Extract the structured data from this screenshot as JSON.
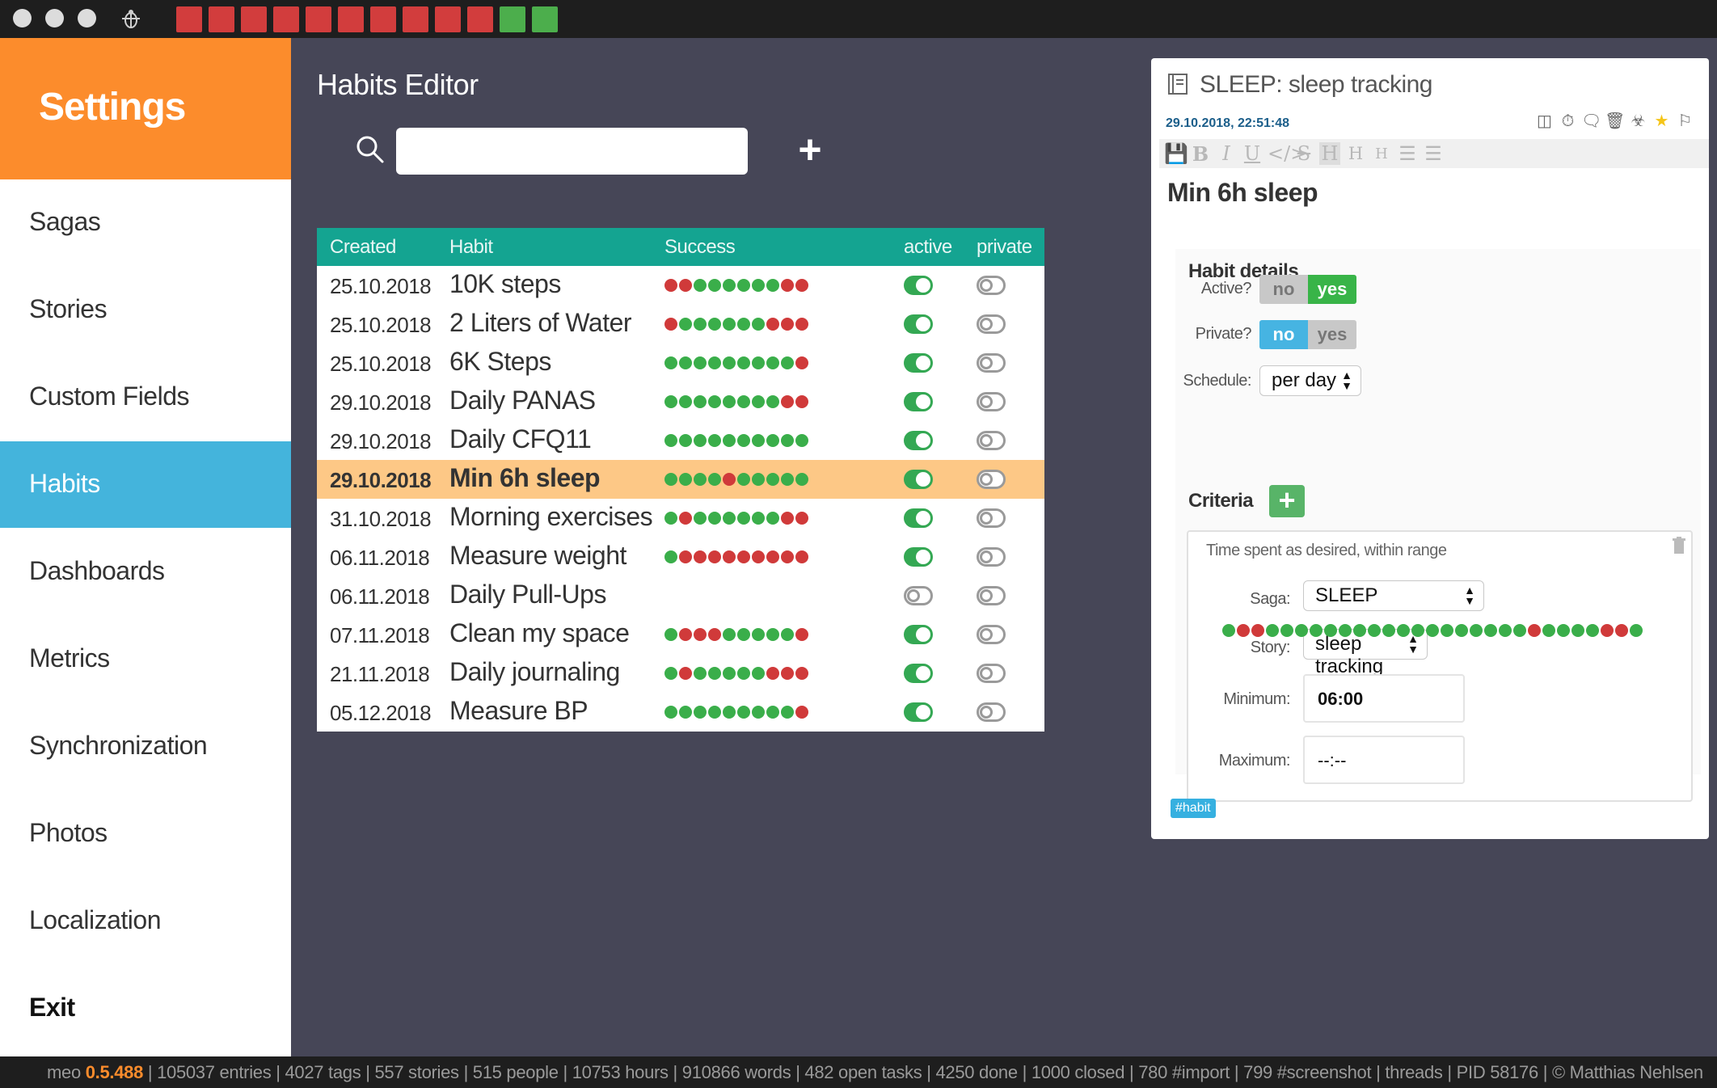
{
  "titlebar": {
    "blocks": [
      "#d23d3d",
      "#d23d3d",
      "#d23d3d",
      "#d23d3d",
      "#d23d3d",
      "#d23d3d",
      "#d23d3d",
      "#d23d3d",
      "#d23d3d",
      "#d23d3d",
      "#4cae4c",
      "#4cae4c"
    ]
  },
  "sidebar": {
    "title": "Settings",
    "items": [
      {
        "label": "Sagas"
      },
      {
        "label": "Stories"
      },
      {
        "label": "Custom Fields"
      },
      {
        "label": "Habits",
        "active": true
      },
      {
        "label": "Dashboards"
      },
      {
        "label": "Metrics"
      },
      {
        "label": "Synchronization"
      },
      {
        "label": "Photos"
      },
      {
        "label": "Localization"
      },
      {
        "label": "Exit"
      }
    ]
  },
  "editor": {
    "title": "Habits Editor",
    "search_value": "",
    "add_label": "+"
  },
  "table": {
    "headers": {
      "created": "Created",
      "habit": "Habit",
      "success": "Success",
      "active": "active",
      "private": "private"
    },
    "rows": [
      {
        "created": "25.10.2018",
        "habit": "10K steps",
        "dots": "rrggggggrr",
        "active": true,
        "private": false
      },
      {
        "created": "25.10.2018",
        "habit": "2 Liters of Water",
        "dots": "rggggggrrr",
        "active": true,
        "private": false
      },
      {
        "created": "25.10.2018",
        "habit": "6K Steps",
        "dots": "gggggggggr",
        "active": true,
        "private": false
      },
      {
        "created": "29.10.2018",
        "habit": "Daily PANAS",
        "dots": "ggggggggrr",
        "active": true,
        "private": false
      },
      {
        "created": "29.10.2018",
        "habit": "Daily CFQ11",
        "dots": "gggggggggg",
        "active": true,
        "private": false
      },
      {
        "created": "29.10.2018",
        "habit": "Min 6h sleep",
        "dots": "ggggrggggg",
        "active": true,
        "private": false,
        "selected": true
      },
      {
        "created": "31.10.2018",
        "habit": "Morning exercises",
        "dots": "grggggggrr",
        "active": true,
        "private": false
      },
      {
        "created": "06.11.2018",
        "habit": "Measure weight",
        "dots": "grrrrrrrrr",
        "active": true,
        "private": false
      },
      {
        "created": "06.11.2018",
        "habit": "Daily Pull-Ups",
        "dots": "",
        "active": false,
        "private": false
      },
      {
        "created": "07.11.2018",
        "habit": "Clean my space",
        "dots": "grrrgggggr",
        "active": true,
        "private": false
      },
      {
        "created": "21.11.2018",
        "habit": "Daily journaling",
        "dots": "grgggggrrr",
        "active": true,
        "private": false
      },
      {
        "created": "05.12.2018",
        "habit": "Measure BP",
        "dots": "gggggggggr",
        "active": true,
        "private": false
      }
    ]
  },
  "detail": {
    "title": "SLEEP: sleep tracking",
    "date": "29.10.2018, 22:51:48",
    "text": "Min 6h sleep",
    "section_title": "Habit details",
    "active_label": "Active?",
    "private_label": "Private?",
    "schedule_label": "Schedule:",
    "no": "no",
    "yes": "yes",
    "schedule_value": "per day",
    "criteria_title": "Criteria",
    "criteria_desc": "Time spent as desired, within range",
    "saga_label": "Saga:",
    "saga_value": "SLEEP",
    "story_label": "Story:",
    "story_value": "sleep tracking",
    "minimum_label": "Minimum:",
    "minimum_value": "06:00",
    "maximum_label": "Maximum:",
    "maximum_value": "--:--",
    "criteria_dots": "grrggggggggggggggggggrggggrrg",
    "tag": "#habit"
  },
  "colors": {
    "green": "#3aae4a",
    "red": "#d03a3a",
    "orange": "#fc8c2c",
    "blue": "#44b4dc",
    "teal": "#14a491"
  },
  "status": {
    "app": "meo",
    "version": "0.5.488",
    "text": " | 105037 entries | 4027 tags | 557 stories | 515 people | 10753 hours | 910866 words | 482 open tasks | 4250 done | 1000 closed | 780 #import | 799 #screenshot | threads | PID 58176 | © Matthias Nehlsen"
  }
}
